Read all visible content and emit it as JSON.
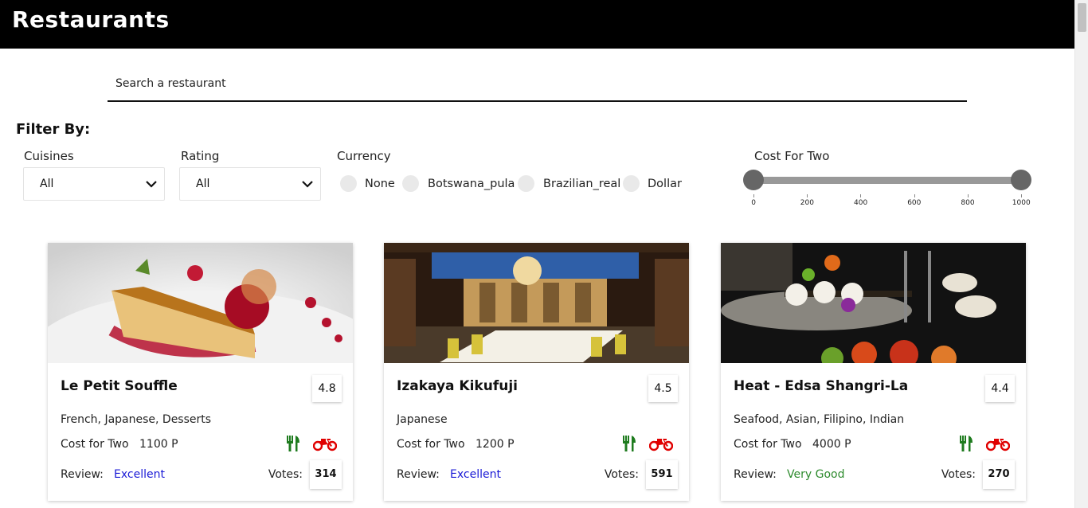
{
  "header": {
    "title": "Restaurants"
  },
  "search": {
    "placeholder": "Search a restaurant"
  },
  "filters": {
    "title": "Filter By:",
    "cuisines": {
      "label": "Cuisines",
      "value": "All"
    },
    "rating": {
      "label": "Rating",
      "value": "All"
    },
    "currency": {
      "label": "Currency",
      "options": [
        "None",
        "Botswana_pula",
        "Brazilian_real",
        "Dollar"
      ]
    },
    "cost": {
      "label": "Cost For Two",
      "ticks": [
        "0",
        "200",
        "400",
        "600",
        "800",
        "1000"
      ],
      "min": 0,
      "max": 1000,
      "range": [
        0,
        1000
      ]
    }
  },
  "colors": {
    "header_bg": "#000000",
    "dine_icon": "#1e7b1e",
    "delivery_icon": "#e00000",
    "excellent": "#1a1ad6",
    "very_good": "#2e8b2e"
  },
  "cards": [
    {
      "name": "Le Petit Souffle",
      "rating": "4.8",
      "cuisines": "French, Japanese, Desserts",
      "cost_label": "Cost for Two",
      "cost": "1100 P",
      "review_label": "Review:",
      "review": "Excellent",
      "review_color": "#1a1ad6",
      "votes_label": "Votes:",
      "votes": "314",
      "image": "dessert-plate-image"
    },
    {
      "name": "Izakaya Kikufuji",
      "rating": "4.5",
      "cuisines": "Japanese",
      "cost_label": "Cost for Two",
      "cost": "1200 P",
      "review_label": "Review:",
      "review": "Excellent",
      "review_color": "#1a1ad6",
      "votes_label": "Votes:",
      "votes": "591",
      "image": "restaurant-interior-image"
    },
    {
      "name": "Heat - Edsa Shangri-La",
      "rating": "4.4",
      "cuisines": "Seafood, Asian, Filipino, Indian",
      "cost_label": "Cost for Two",
      "cost": "4000 P",
      "review_label": "Review:",
      "review": "Very Good",
      "review_color": "#2e8b2e",
      "votes_label": "Votes:",
      "votes": "270",
      "image": "sushi-platter-image"
    }
  ]
}
